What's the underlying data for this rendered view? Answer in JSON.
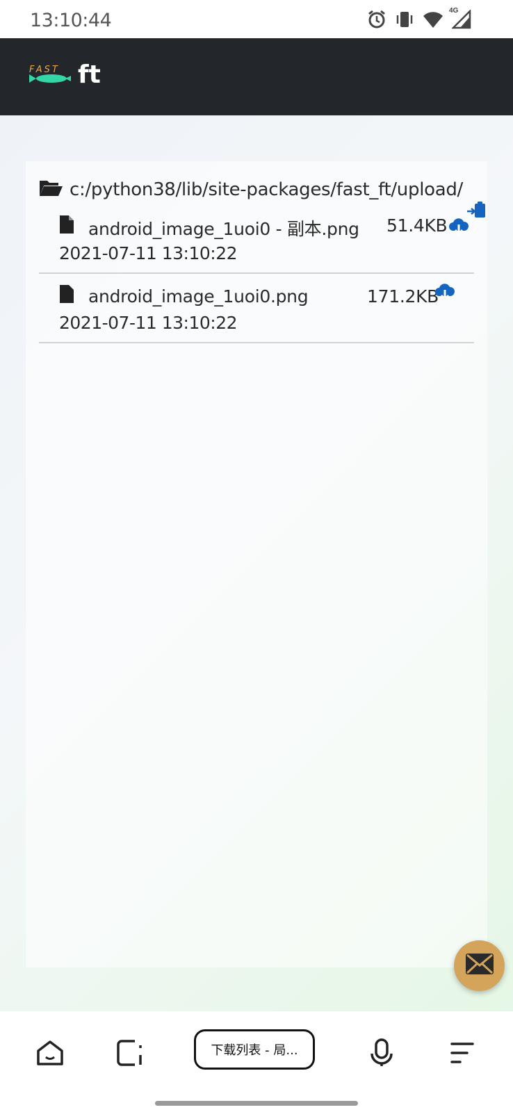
{
  "status_bar": {
    "time": "13:10:44",
    "network_label": "4G"
  },
  "header": {
    "logo_small_text": "FAST",
    "logo_text": "ft"
  },
  "directory": {
    "path": "c:/python38/lib/site-packages/fast_ft/upload/"
  },
  "files": [
    {
      "name": "android_image_1uoi0 - 副本.png",
      "size": "51.4KB",
      "date": "2021-07-11 13:10:22"
    },
    {
      "name": "android_image_1uoi0.png",
      "size": "171.2KB",
      "date": "2021-07-11 13:10:22"
    }
  ],
  "bottom_bar": {
    "tab_label": "下载列表 - 局..."
  },
  "colors": {
    "header_bg": "#23272b",
    "accent_blue": "#1565c0",
    "fab": "#d4a45a",
    "logo_orange": "#e7a54a",
    "logo_green": "#33d6a6"
  }
}
